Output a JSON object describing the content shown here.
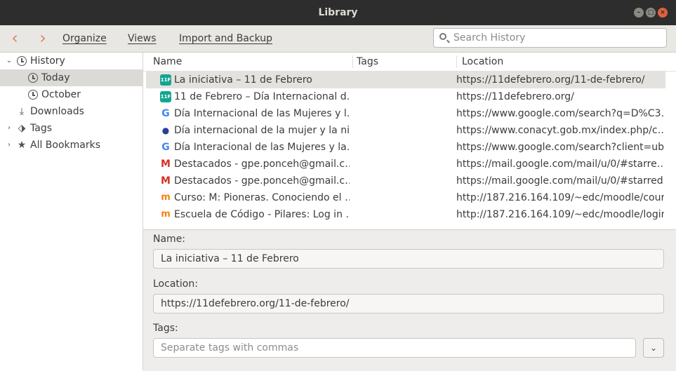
{
  "window": {
    "title": "Library"
  },
  "toolbar": {
    "back_icon": "back-arrow-icon",
    "forward_icon": "forward-arrow-icon",
    "organize": "Organize",
    "views": "Views",
    "import_backup": "Import and Backup",
    "search_placeholder": "Search History",
    "accent": "#d9855f"
  },
  "sidebar": {
    "items": [
      {
        "label": "History",
        "icon": "clock-icon",
        "twisty": "expanded"
      },
      {
        "label": "Today",
        "icon": "clock-icon",
        "selected": true
      },
      {
        "label": "October",
        "icon": "clock-icon"
      },
      {
        "label": "Downloads",
        "icon": "download-icon"
      },
      {
        "label": "Tags",
        "icon": "tag-icon",
        "twisty": "collapsed"
      },
      {
        "label": "All Bookmarks",
        "icon": "star-icon",
        "twisty": "collapsed"
      }
    ]
  },
  "table": {
    "columns": [
      "Name",
      "Tags",
      "Location"
    ],
    "rows": [
      {
        "name": "La iniciativa – 11 de Febrero",
        "location": "https://11defebrero.org/11-de-febrero/",
        "favicon": "11f-icon",
        "selected": true
      },
      {
        "name": "11 de Febrero – Día Internacional d…",
        "location": "https://11defebrero.org/",
        "favicon": "11f-icon"
      },
      {
        "name": "Día Internacional de las Mujeres y l…",
        "location": "https://www.google.com/search?q=D%C3…",
        "favicon": "google-icon"
      },
      {
        "name": "Día internacional de la mujer y la ni…",
        "location": "https://www.conacyt.gob.mx/index.php/c…",
        "favicon": "conacyt-icon"
      },
      {
        "name": "Día Interacional de las Mujeres y la…",
        "location": "https://www.google.com/search?client=ub…",
        "favicon": "google-icon"
      },
      {
        "name": "Destacados - gpe.ponceh@gmail.c…",
        "location": "https://mail.google.com/mail/u/0/#starre…",
        "favicon": "gmail-icon"
      },
      {
        "name": "Destacados - gpe.ponceh@gmail.c…",
        "location": "https://mail.google.com/mail/u/0/#starred",
        "favicon": "gmail-icon"
      },
      {
        "name": "Curso: M: Pioneras. Conociendo el …",
        "location": "http://187.216.164.109/~edc/moodle/cour…",
        "favicon": "moodle-icon"
      },
      {
        "name": "Escuela de Código - Pilares: Log in …",
        "location": "http://187.216.164.109/~edc/moodle/login…",
        "favicon": "moodle-icon"
      }
    ]
  },
  "details": {
    "name_label": "Name:",
    "name_value": "La iniciativa – 11 de Febrero",
    "location_label": "Location:",
    "location_value": "https://11defebrero.org/11-de-febrero/",
    "tags_label": "Tags:",
    "tags_placeholder": "Separate tags with commas",
    "tags_button_icon": "chevron-down-icon"
  }
}
